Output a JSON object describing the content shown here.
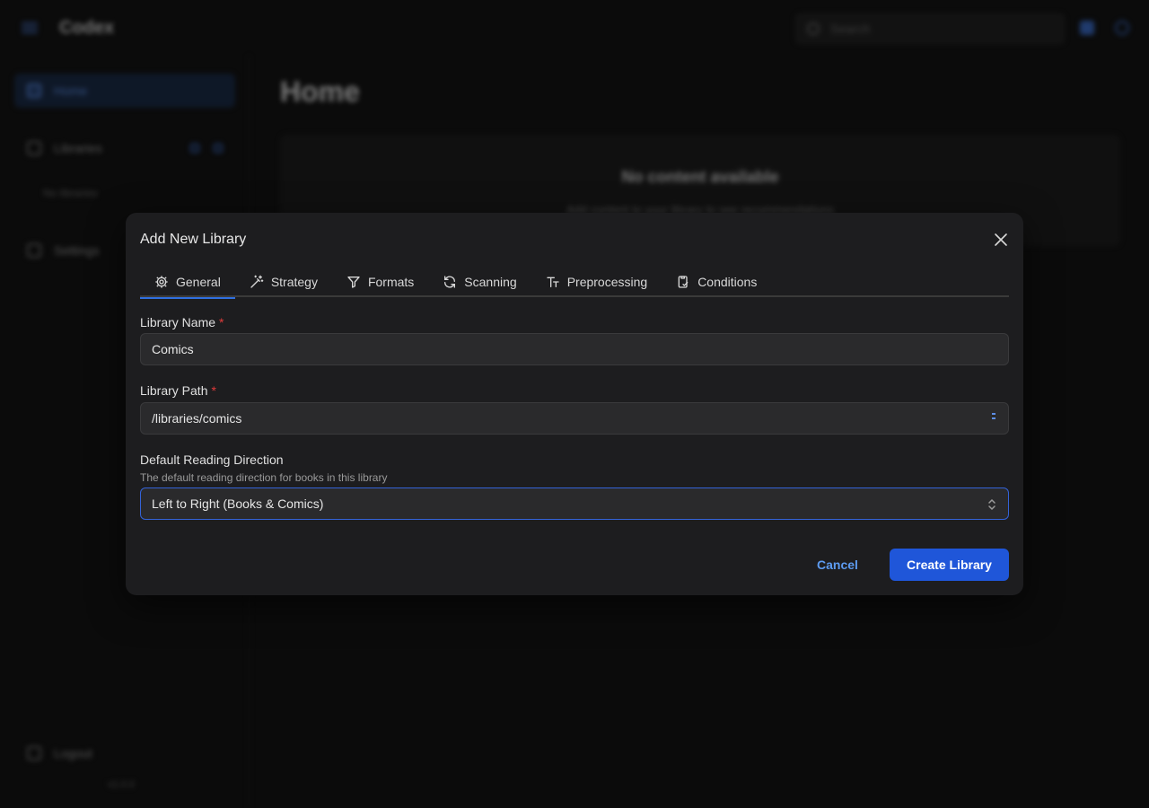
{
  "app": {
    "brand": "Codex",
    "search_placeholder": "Search",
    "sidebar": {
      "home": "Home",
      "libraries": "Libraries",
      "no_libraries": "No libraries",
      "settings": "Settings",
      "logout": "Logout",
      "version": "v1.0.0"
    },
    "main": {
      "title": "Home",
      "empty_heading": "No content available",
      "empty_text": "Add content to your library to see recommendations"
    }
  },
  "modal": {
    "title": "Add New Library",
    "tabs": [
      {
        "label": "General",
        "icon": "gear-icon",
        "active": true
      },
      {
        "label": "Strategy",
        "icon": "wand-icon",
        "active": false
      },
      {
        "label": "Formats",
        "icon": "filter-icon",
        "active": false
      },
      {
        "label": "Scanning",
        "icon": "refresh-icon",
        "active": false
      },
      {
        "label": "Preprocessing",
        "icon": "text-size-icon",
        "active": false
      },
      {
        "label": "Conditions",
        "icon": "clipboard-check-icon",
        "active": false
      }
    ],
    "fields": {
      "name": {
        "label": "Library Name",
        "required_mark": "*",
        "value": "Comics"
      },
      "path": {
        "label": "Library Path",
        "required_mark": "*",
        "value": "/libraries/comics"
      },
      "direction": {
        "label": "Default Reading Direction",
        "description": "The default reading direction for books in this library",
        "value": "Left to Right (Books & Comics)"
      }
    },
    "buttons": {
      "cancel": "Cancel",
      "create": "Create Library"
    },
    "colors": {
      "accent": "#1f56d9",
      "link": "#5d9bf0",
      "required": "#e03b3b"
    }
  }
}
